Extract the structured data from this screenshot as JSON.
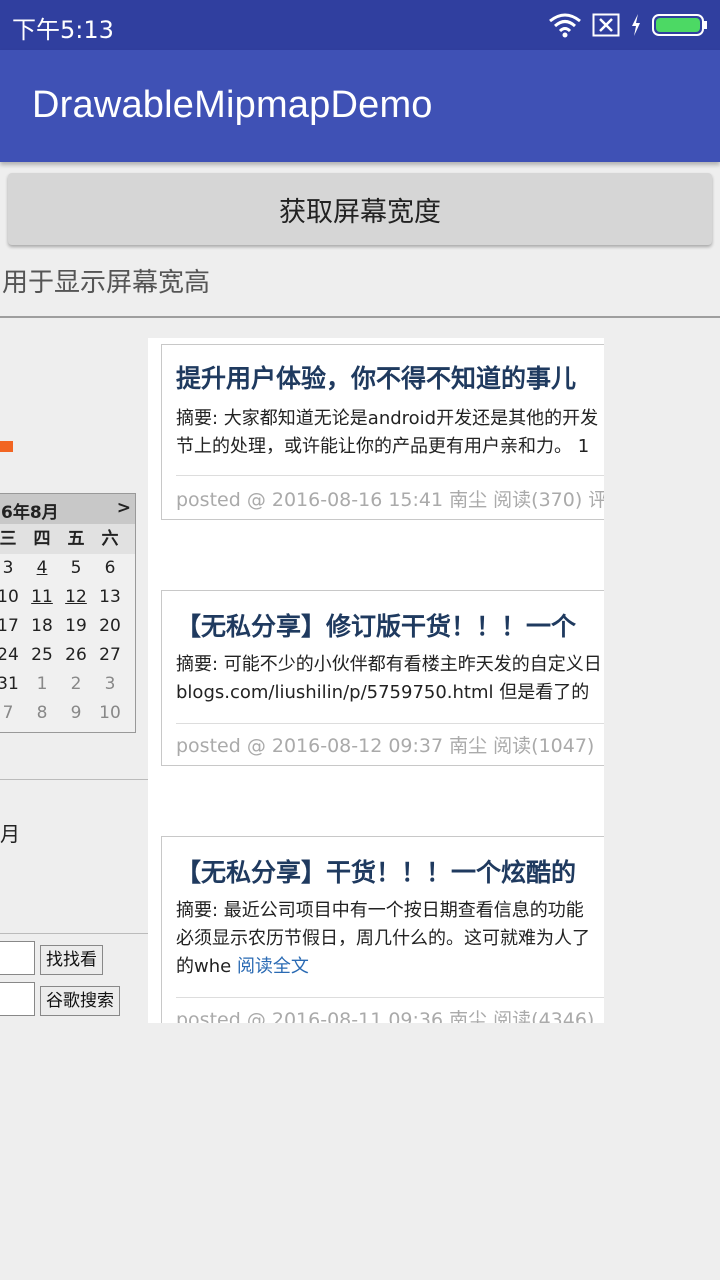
{
  "status": {
    "time": "下午5:13",
    "colors": {
      "bar": "#303f9f",
      "battery": "#4cd964"
    }
  },
  "toolbar": {
    "title": "DrawableMipmapDemo"
  },
  "main": {
    "button_label": "获取屏幕宽度",
    "info_text": "用于显示屏幕宽高"
  },
  "web": {
    "calendar": {
      "month": "6年8月",
      "next": ">",
      "weekdays": [
        "三",
        "四",
        "五",
        "六"
      ],
      "rows": [
        [
          "3",
          "4",
          "5",
          "6"
        ],
        [
          "10",
          "11",
          "12",
          "13"
        ],
        [
          "17",
          "18",
          "19",
          "20"
        ],
        [
          "24",
          "25",
          "26",
          "27"
        ],
        [
          "31",
          "1",
          "2",
          "3"
        ],
        [
          "7",
          "8",
          "9",
          "10"
        ]
      ]
    },
    "sidebar_month_fragment": "月",
    "search": {
      "button1": "找找看",
      "button2": "谷歌搜索"
    },
    "posts": [
      {
        "title": "提升用户体验，你不得不知道的事儿",
        "summary_lines": [
          "摘要: 大家都知道无论是android开发还是其他的开发",
          "节上的处理，或许能让你的产品更有用户亲和力。 1"
        ],
        "read_more": "",
        "footer": "posted @ 2016-08-16 15:41 南尘 阅读(370) 评"
      },
      {
        "title": "【无私分享】修订版干货！！！一个",
        "summary_lines": [
          "摘要: 可能不少的小伙伴都有看楼主昨天发的自定义日",
          "blogs.com/liushilin/p/5759750.html 但是看了的"
        ],
        "read_more": "",
        "footer": "posted @ 2016-08-12 09:37 南尘 阅读(1047)"
      },
      {
        "title": "【无私分享】干货！！！一个炫酷的",
        "summary_lines": [
          "摘要: 最近公司项目中有一个按日期查看信息的功能",
          "必须显示农历节假日，周几什么的。这可就难为人了",
          "的whe "
        ],
        "read_more": "阅读全文",
        "footer": "posted @ 2016-08-11 09:36 南尘 阅读(4346)"
      }
    ]
  }
}
